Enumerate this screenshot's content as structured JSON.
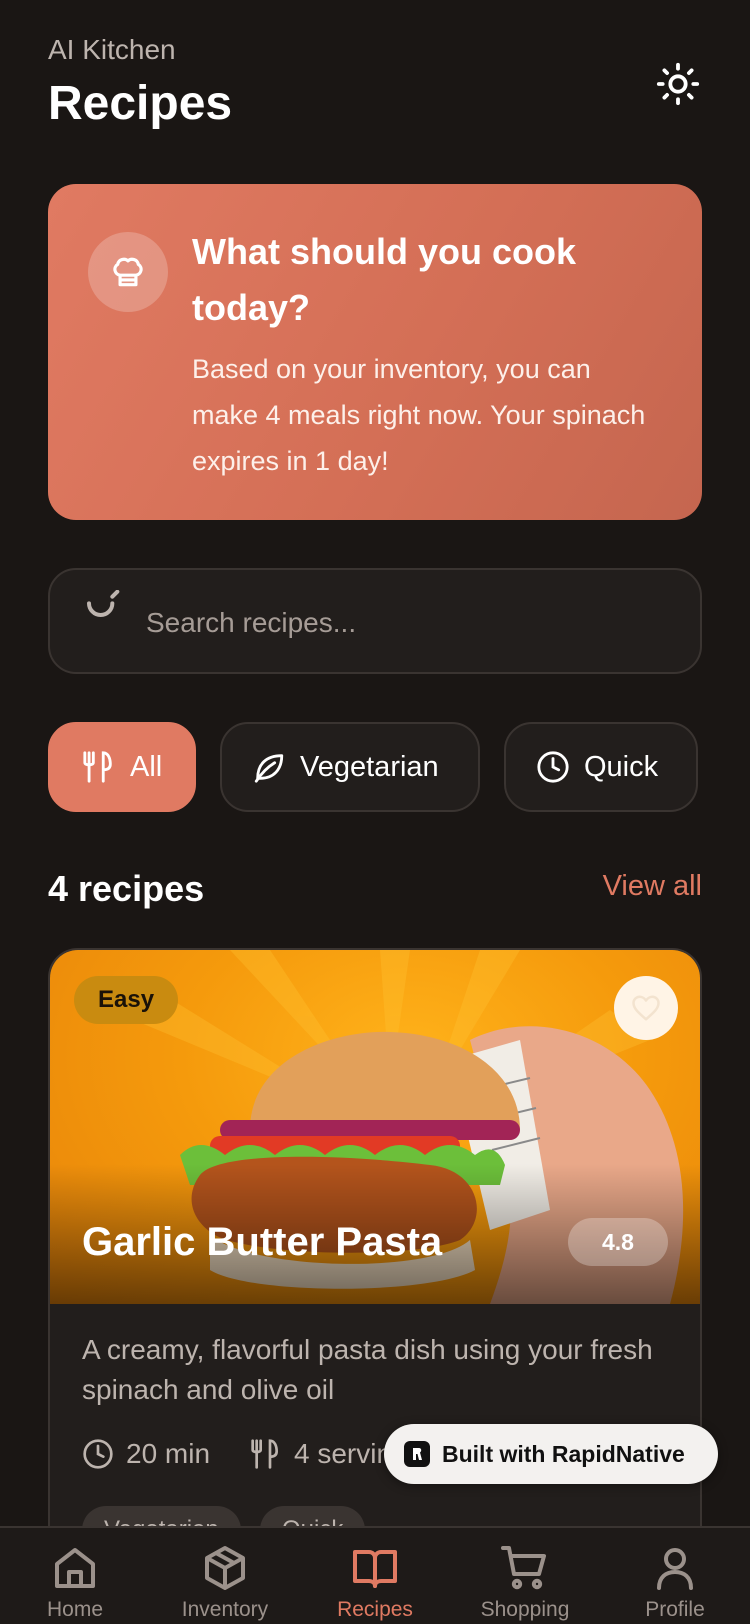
{
  "header": {
    "app_name": "AI Kitchen",
    "title": "Recipes",
    "theme_icon": "sun-icon"
  },
  "hero": {
    "icon": "chef-hat-icon",
    "title": "What should you cook today?",
    "text": "Based on your inventory, you can make 4 meals right now. Your spinach expires in 1 day!"
  },
  "search": {
    "placeholder": "Search recipes...",
    "value": ""
  },
  "filters": [
    {
      "label": "All",
      "icon": "utensils-icon",
      "active": true
    },
    {
      "label": "Vegetarian",
      "icon": "leaf-icon",
      "active": false
    },
    {
      "label": "Quick",
      "icon": "clock-icon",
      "active": false
    }
  ],
  "section": {
    "count_label": "4 recipes",
    "view_all": "View all"
  },
  "recipe": {
    "difficulty": "Easy",
    "title": "Garlic Butter Pasta",
    "rating": "4.8",
    "description": "A creamy, flavorful pasta dish using your fresh spinach and olive oil",
    "time": "20 min",
    "servings": "4 servings",
    "tags": [
      "Vegetarian",
      "Quick"
    ]
  },
  "built_with": "Built with RapidNative",
  "nav": [
    {
      "label": "Home",
      "icon": "home-icon",
      "active": false
    },
    {
      "label": "Inventory",
      "icon": "box-icon",
      "active": false
    },
    {
      "label": "Recipes",
      "icon": "book-icon",
      "active": true
    },
    {
      "label": "Shopping",
      "icon": "cart-icon",
      "active": false
    },
    {
      "label": "Profile",
      "icon": "user-icon",
      "active": false
    }
  ],
  "colors": {
    "background": "#1a1614",
    "accent": "#e07a62",
    "surface": "#221e1c",
    "muted_text": "#bdb4ae"
  }
}
